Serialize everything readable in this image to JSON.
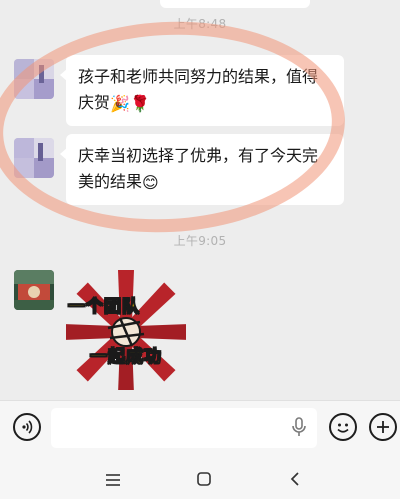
{
  "chat": {
    "timestamp_1": "上午8:48",
    "timestamp_2": "上午9:05",
    "messages": [
      {
        "text": "孩子和老师共同努力的结果，值得庆贺",
        "emojis": "🎉🌹"
      },
      {
        "text": "庆幸当初选择了优弗，有了今天完美的结果",
        "emojis": "😊"
      }
    ],
    "sticker": {
      "line1": "一个团队",
      "line2": "一起成功"
    }
  },
  "icons": {
    "voice": "voice-mode-icon",
    "mic": "microphone-icon",
    "emoji": "emoji-icon",
    "plus": "plus-icon",
    "nav_menu": "menu-icon",
    "nav_home": "home-icon",
    "nav_back": "back-icon"
  },
  "colors": {
    "background": "#ededed",
    "bubble": "#ffffff",
    "timestamp": "#b2b2b2",
    "annotation": "#f0967a",
    "sticker_text": "#ffd400",
    "sticker_red": "#b8242a"
  }
}
